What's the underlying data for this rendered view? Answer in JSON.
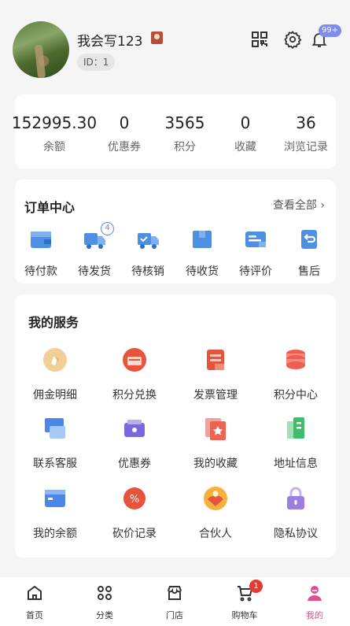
{
  "profile": {
    "nickname": "我会写123",
    "id_label": "ID：1",
    "notification_count": "99+"
  },
  "stats": [
    {
      "value": "152995.30",
      "label": "余额"
    },
    {
      "value": "0",
      "label": "优惠券"
    },
    {
      "value": "3565",
      "label": "积分"
    },
    {
      "value": "0",
      "label": "收藏"
    },
    {
      "value": "36",
      "label": "浏览记录"
    }
  ],
  "orders": {
    "title": "订单中心",
    "view_all": "查看全部",
    "items": [
      {
        "label": "待付款",
        "icon": "wallet-icon"
      },
      {
        "label": "待发货",
        "icon": "truck-icon",
        "badge": "4"
      },
      {
        "label": "待核销",
        "icon": "truck-check-icon"
      },
      {
        "label": "待收货",
        "icon": "package-icon"
      },
      {
        "label": "待评价",
        "icon": "review-icon"
      },
      {
        "label": "售后",
        "icon": "refund-icon"
      }
    ]
  },
  "services": {
    "title": "我的服务",
    "items": [
      {
        "label": "佣金明细",
        "icon": "commission-icon",
        "color": "#e8b86b"
      },
      {
        "label": "积分兑换",
        "icon": "exchange-icon",
        "color": "#e8533c"
      },
      {
        "label": "发票管理",
        "icon": "invoice-icon",
        "color": "#e8533c"
      },
      {
        "label": "积分中心",
        "icon": "points-stack-icon",
        "color": "#ee5d4f"
      },
      {
        "label": "联系客服",
        "icon": "service-icon",
        "color": "#4c86e8"
      },
      {
        "label": "优惠券",
        "icon": "coupon-icon",
        "color": "#7b68e0"
      },
      {
        "label": "我的收藏",
        "icon": "favorite-icon",
        "color": "#ee6452"
      },
      {
        "label": "地址信息",
        "icon": "address-icon",
        "color": "#3fbd6a"
      },
      {
        "label": "我的余额",
        "icon": "balance-icon",
        "color": "#4c86e8"
      },
      {
        "label": "砍价记录",
        "icon": "bargain-icon",
        "color": "#e8533c"
      },
      {
        "label": "合伙人",
        "icon": "partner-icon",
        "color": "#ef7a3c"
      },
      {
        "label": "隐私协议",
        "icon": "privacy-lock-icon",
        "color": "#9c7ee0"
      }
    ]
  },
  "tabbar": [
    {
      "label": "首页",
      "icon": "home-icon"
    },
    {
      "label": "分类",
      "icon": "category-icon"
    },
    {
      "label": "门店",
      "icon": "store-icon"
    },
    {
      "label": "购物车",
      "icon": "cart-icon",
      "badge": "1"
    },
    {
      "label": "我的",
      "icon": "profile-icon",
      "active": true
    }
  ],
  "colors": {
    "accent": "#e0508f",
    "order_icon": "#4c8fe3",
    "badge_red": "#e43b32"
  }
}
